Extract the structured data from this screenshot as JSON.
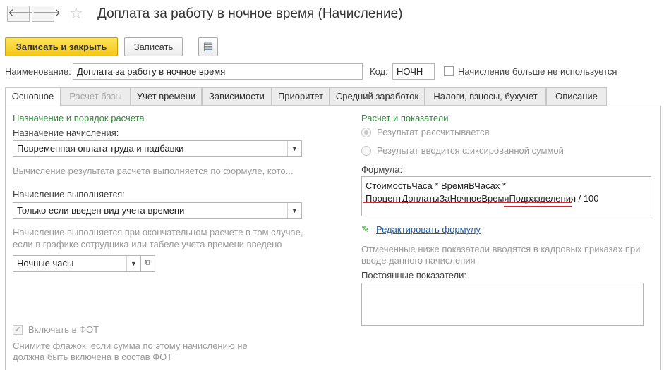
{
  "window": {
    "title": "Доплата за работу в ночное время (Начисление)",
    "back_glyph": "🡐",
    "forward_glyph": "🡒",
    "star_glyph": "☆"
  },
  "toolbar": {
    "save_close_label": "Записать и закрыть",
    "save_label": "Записать",
    "report_glyph": "▤"
  },
  "header": {
    "name_label": "Наименование:",
    "name_value": "Доплата за работу в ночное время",
    "code_label": "Код:",
    "code_value": "НОЧН",
    "unused_label": "Начисление больше не используется"
  },
  "tabs": [
    {
      "label": "Основное"
    },
    {
      "label": "Расчет базы"
    },
    {
      "label": "Учет времени"
    },
    {
      "label": "Зависимости"
    },
    {
      "label": "Приоритет"
    },
    {
      "label": "Средний заработок"
    },
    {
      "label": "Налоги, взносы, бухучет"
    },
    {
      "label": "Описание"
    }
  ],
  "left": {
    "section_title": "Назначение и порядок расчета",
    "purpose_label": "Назначение начисления:",
    "purpose_value": "Повременная оплата труда и надбавки",
    "purpose_hint": "Вычисление результата расчета выполняется по формуле, кото...",
    "performed_label": "Начисление выполняется:",
    "performed_value": "Только если введен вид учета времени",
    "performed_hint_line1": "Начисление выполняется при окончательном расчете в том случае,",
    "performed_hint_line2": "если в графике сотрудника или табеле учета времени введено",
    "time_type_value": "Ночные часы",
    "fot_label": "Включать в ФОТ",
    "fot_hint_line1": "Снимите флажок, если сумма по этому начислению не",
    "fot_hint_line2": "должна быть включена в состав ФОТ"
  },
  "right": {
    "section_title": "Расчет и показатели",
    "radio_calculated": "Результат рассчитывается",
    "radio_fixed": "Результат вводится фиксированной суммой",
    "formula_label": "Формула:",
    "formula_line1": "СтоимостьЧаса * ВремяВЧасах *",
    "formula_line2": "ПроцентДоплатыЗаНочноеВремяПодразделения / 100",
    "edit_formula_link": "Редактировать формулу",
    "indicators_hint_line1": "Отмеченные ниже показатели вводятся в кадровых приказах при",
    "indicators_hint_line2": "вводе данного начисления",
    "constant_label": "Постоянные показатели:"
  },
  "colors": {
    "accent_yellow": "#f5c518",
    "section_green": "#2e8b3a",
    "link_blue": "#1f5fa8",
    "annotation_red": "#d9232d"
  }
}
